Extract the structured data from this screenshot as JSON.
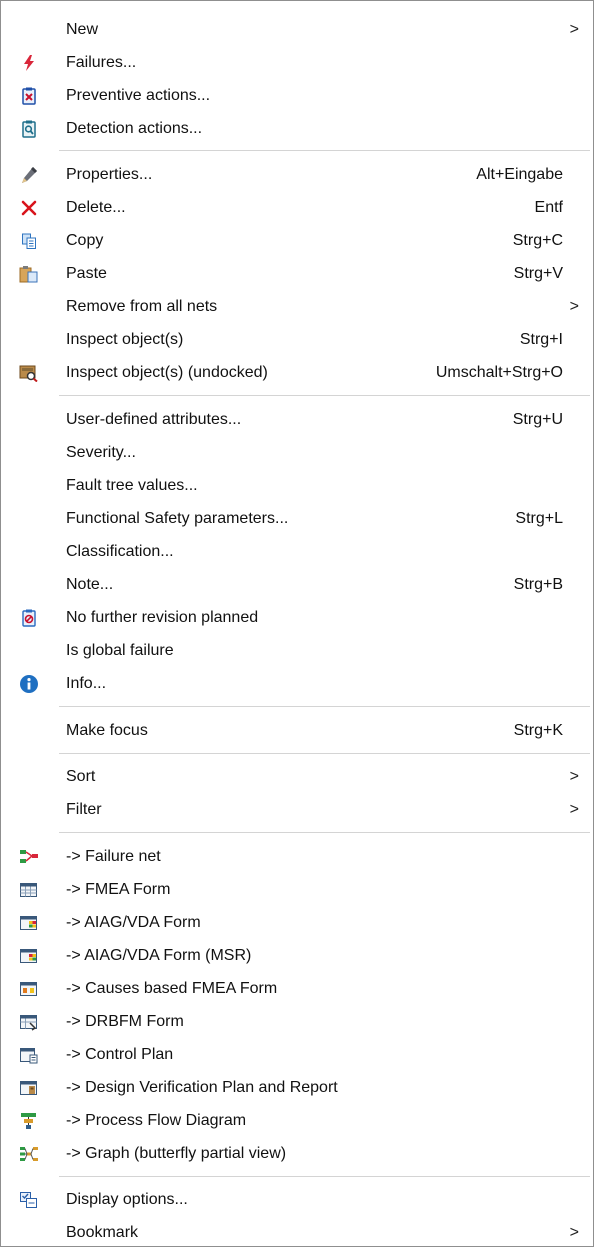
{
  "menu": {
    "items": [
      {
        "label": "New",
        "shortcut": "",
        "submenu": ">",
        "icon": ""
      },
      {
        "label": "Failures...",
        "shortcut": "",
        "submenu": "",
        "icon": "failure-lightning-icon"
      },
      {
        "label": "Preventive actions...",
        "shortcut": "",
        "submenu": "",
        "icon": "preventive-action-icon"
      },
      {
        "label": "Detection actions...",
        "shortcut": "",
        "submenu": "",
        "icon": "detection-action-icon"
      },
      {
        "label": "Properties...",
        "shortcut": "Alt+Eingabe",
        "submenu": "",
        "icon": "pencil-icon"
      },
      {
        "label": "Delete...",
        "shortcut": "Entf",
        "submenu": "",
        "icon": "delete-x-icon"
      },
      {
        "label": "Copy",
        "shortcut": "Strg+C",
        "submenu": "",
        "icon": "copy-icon"
      },
      {
        "label": "Paste",
        "shortcut": "Strg+V",
        "submenu": "",
        "icon": "paste-icon"
      },
      {
        "label": "Remove from all nets",
        "shortcut": "",
        "submenu": ">",
        "icon": ""
      },
      {
        "label": "Inspect object(s)",
        "shortcut": "Strg+I",
        "submenu": "",
        "icon": ""
      },
      {
        "label": "Inspect object(s) (undocked)",
        "shortcut": "Umschalt+Strg+O",
        "submenu": "",
        "icon": "inspect-undocked-icon"
      },
      {
        "label": "User-defined attributes...",
        "shortcut": "Strg+U",
        "submenu": "",
        "icon": ""
      },
      {
        "label": "Severity...",
        "shortcut": "",
        "submenu": "",
        "icon": ""
      },
      {
        "label": "Fault tree values...",
        "shortcut": "",
        "submenu": "",
        "icon": ""
      },
      {
        "label": "Functional Safety parameters...",
        "shortcut": "Strg+L",
        "submenu": "",
        "icon": ""
      },
      {
        "label": "Classification...",
        "shortcut": "",
        "submenu": "",
        "icon": ""
      },
      {
        "label": "Note...",
        "shortcut": "Strg+B",
        "submenu": "",
        "icon": ""
      },
      {
        "label": "No further revision planned",
        "shortcut": "",
        "submenu": "",
        "icon": "no-revision-icon"
      },
      {
        "label": "Is global failure",
        "shortcut": "",
        "submenu": "",
        "icon": ""
      },
      {
        "label": "Info...",
        "shortcut": "",
        "submenu": "",
        "icon": "info-icon"
      },
      {
        "label": "Make focus",
        "shortcut": "Strg+K",
        "submenu": "",
        "icon": ""
      },
      {
        "label": "Sort",
        "shortcut": "",
        "submenu": ">",
        "icon": ""
      },
      {
        "label": "Filter",
        "shortcut": "",
        "submenu": ">",
        "icon": ""
      },
      {
        "label": "-> Failure net",
        "shortcut": "",
        "submenu": "",
        "icon": "failure-net-icon"
      },
      {
        "label": "-> FMEA Form",
        "shortcut": "",
        "submenu": "",
        "icon": "fmea-form-icon"
      },
      {
        "label": "-> AIAG/VDA Form",
        "shortcut": "",
        "submenu": "",
        "icon": "aiag-vda-form-icon"
      },
      {
        "label": "-> AIAG/VDA Form (MSR)",
        "shortcut": "",
        "submenu": "",
        "icon": "aiag-vda-msr-form-icon"
      },
      {
        "label": "-> Causes based FMEA Form",
        "shortcut": "",
        "submenu": "",
        "icon": "causes-fmea-form-icon"
      },
      {
        "label": "-> DRBFM Form",
        "shortcut": "",
        "submenu": "",
        "icon": "drbfm-form-icon"
      },
      {
        "label": "-> Control Plan",
        "shortcut": "",
        "submenu": "",
        "icon": "control-plan-icon"
      },
      {
        "label": "-> Design Verification Plan and Report",
        "shortcut": "",
        "submenu": "",
        "icon": "dvpr-icon"
      },
      {
        "label": "-> Process Flow Diagram",
        "shortcut": "",
        "submenu": "",
        "icon": "process-flow-icon"
      },
      {
        "label": "-> Graph (butterfly partial view)",
        "shortcut": "",
        "submenu": "",
        "icon": "butterfly-graph-icon"
      },
      {
        "label": "Display options...",
        "shortcut": "",
        "submenu": "",
        "icon": "display-options-icon"
      },
      {
        "label": "Bookmark",
        "shortcut": "",
        "submenu": ">",
        "icon": ""
      }
    ]
  }
}
